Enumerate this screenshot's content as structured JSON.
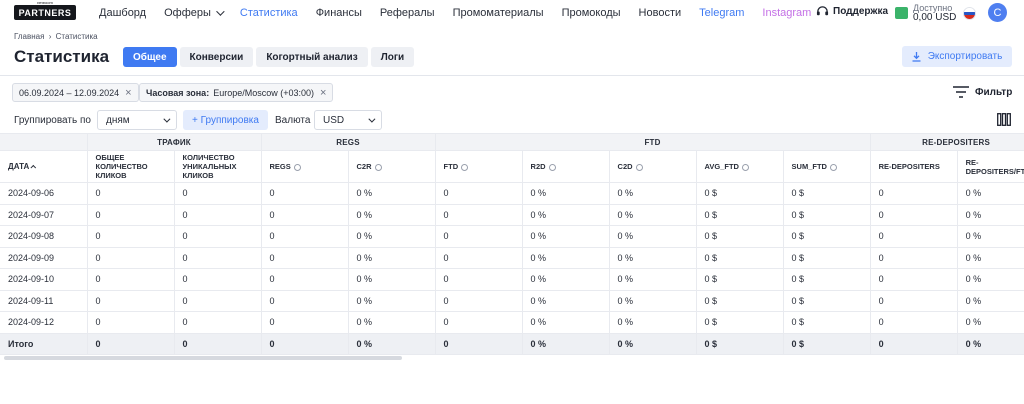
{
  "brand": {
    "logo_text": "PARTNERS",
    "logo_small": "betboom"
  },
  "nav": {
    "items": [
      {
        "label": "Дашборд",
        "key": "dashboard"
      },
      {
        "label": "Офферы",
        "key": "offers",
        "dropdown": true
      },
      {
        "label": "Статистика",
        "key": "stats",
        "active": true
      },
      {
        "label": "Финансы",
        "key": "finance"
      },
      {
        "label": "Рефералы",
        "key": "referrals"
      },
      {
        "label": "Промоматериалы",
        "key": "promo"
      },
      {
        "label": "Промокоды",
        "key": "promocodes"
      },
      {
        "label": "Новости",
        "key": "news"
      },
      {
        "label": "Telegram",
        "key": "telegram"
      },
      {
        "label": "Instagram",
        "key": "instagram"
      }
    ],
    "support_label": "Поддержка",
    "balance_label": "Доступно",
    "balance_value": "0,00 USD",
    "avatar_letter": "C"
  },
  "breadcrumb": {
    "home": "Главная",
    "separator": "›",
    "current": "Статистика"
  },
  "page": {
    "title": "Статистика",
    "tabs": [
      "Общее",
      "Конверсии",
      "Когортный анализ",
      "Логи"
    ],
    "active_tab": 0,
    "export_label": "Экспортировать"
  },
  "filters": {
    "date_range": "06.09.2024 – 12.09.2024",
    "timezone_label": "Часовая зона:",
    "timezone_value": "Europe/Moscow (+03:00)",
    "filter_label": "Фильтр"
  },
  "grouping": {
    "label": "Группировать по",
    "value": "дням",
    "add_label": "+ Группировка",
    "currency_label": "Валюта",
    "currency_value": "USD"
  },
  "table": {
    "groups": [
      {
        "label": "",
        "span": 1
      },
      {
        "label": "ТРАФИК",
        "span": 2
      },
      {
        "label": "REGS",
        "span": 2
      },
      {
        "label": "FTD",
        "span": 5
      },
      {
        "label": "RE-DEPOSITERS",
        "span": 2
      }
    ],
    "columns": [
      {
        "label": "ДАТА",
        "sort": true
      },
      {
        "label": "ОБЩЕЕ КОЛИЧЕСТВО КЛИКОВ"
      },
      {
        "label": "КОЛИЧЕСТВО УНИКАЛЬНЫХ КЛИКОВ"
      },
      {
        "label": "REGS",
        "info": true
      },
      {
        "label": "C2R",
        "info": true
      },
      {
        "label": "FTD",
        "info": true
      },
      {
        "label": "R2D",
        "info": true
      },
      {
        "label": "C2D",
        "info": true
      },
      {
        "label": "AVG_FTD",
        "info": true
      },
      {
        "label": "SUM_FTD",
        "info": true
      },
      {
        "label": "RE-DEPOSITERS"
      },
      {
        "label": "RE-DEPOSITERS/FTD"
      }
    ],
    "rows": [
      [
        "2024-09-06",
        "0",
        "0",
        "0",
        "0 %",
        "0",
        "0 %",
        "0 %",
        "0 $",
        "0 $",
        "0",
        "0 %"
      ],
      [
        "2024-09-07",
        "0",
        "0",
        "0",
        "0 %",
        "0",
        "0 %",
        "0 %",
        "0 $",
        "0 $",
        "0",
        "0 %"
      ],
      [
        "2024-09-08",
        "0",
        "0",
        "0",
        "0 %",
        "0",
        "0 %",
        "0 %",
        "0 $",
        "0 $",
        "0",
        "0 %"
      ],
      [
        "2024-09-09",
        "0",
        "0",
        "0",
        "0 %",
        "0",
        "0 %",
        "0 %",
        "0 $",
        "0 $",
        "0",
        "0 %"
      ],
      [
        "2024-09-10",
        "0",
        "0",
        "0",
        "0 %",
        "0",
        "0 %",
        "0 %",
        "0 $",
        "0 $",
        "0",
        "0 %"
      ],
      [
        "2024-09-11",
        "0",
        "0",
        "0",
        "0 %",
        "0",
        "0 %",
        "0 %",
        "0 $",
        "0 $",
        "0",
        "0 %"
      ],
      [
        "2024-09-12",
        "0",
        "0",
        "0",
        "0 %",
        "0",
        "0 %",
        "0 %",
        "0 $",
        "0 $",
        "0",
        "0 %"
      ]
    ],
    "total": [
      "Итого",
      "0",
      "0",
      "0",
      "0 %",
      "0",
      "0 %",
      "0 %",
      "0 $",
      "0 $",
      "0",
      "0 %"
    ]
  },
  "colors": {
    "accent": "#3f7af2",
    "instagram": "#c470e6",
    "chip_bg": "#e4ecfd",
    "wallet": "#3bb36a"
  }
}
